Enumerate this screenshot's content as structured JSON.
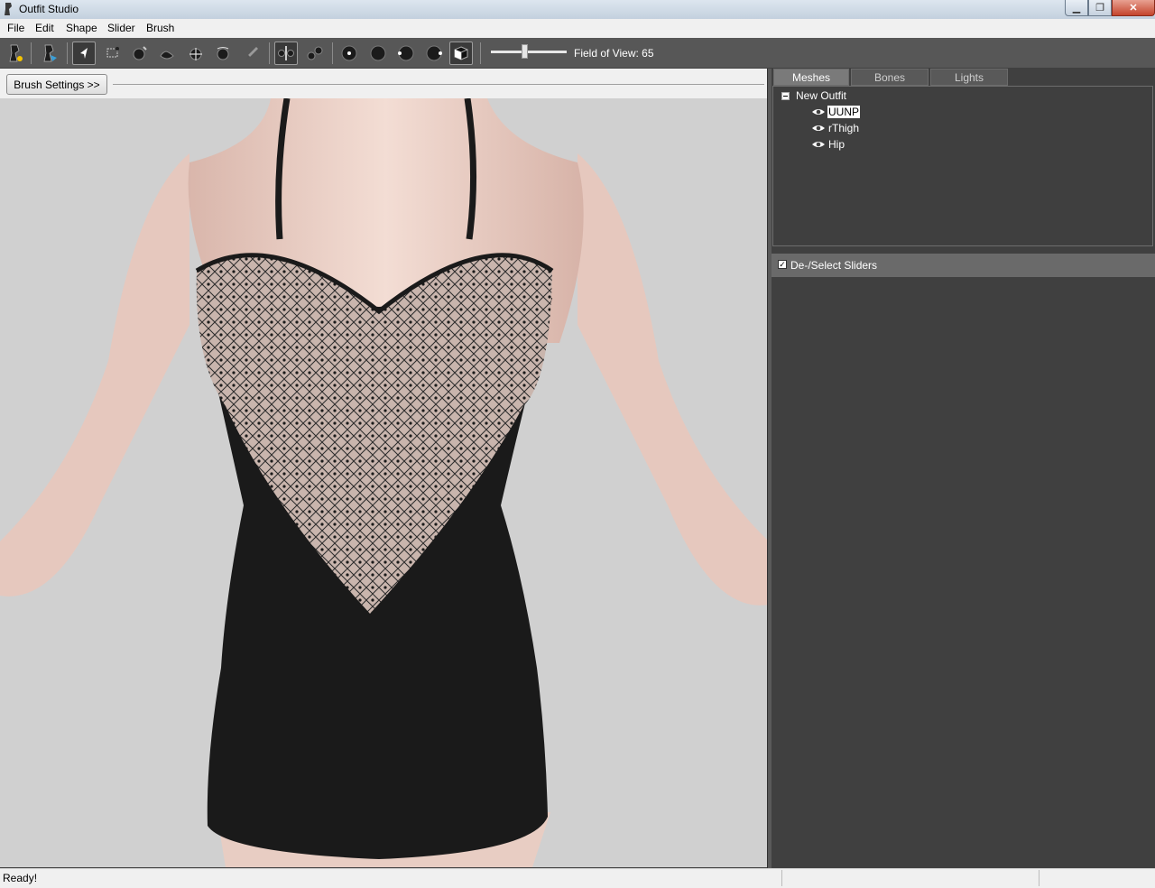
{
  "window": {
    "title": "Outfit Studio"
  },
  "menu": [
    "File",
    "Edit",
    "Shape",
    "Slider",
    "Brush"
  ],
  "toolbar": {
    "fov_label": "Field of View: 65",
    "fov_value": 65
  },
  "viewport": {
    "brush_settings_label": "Brush Settings >>"
  },
  "panel": {
    "tabs": [
      "Meshes",
      "Bones",
      "Lights"
    ],
    "tree": {
      "root": "New Outfit",
      "items": [
        "UUNP",
        "rThigh",
        "Hip"
      ]
    },
    "sliders_header": "De-/Select Sliders"
  },
  "status": {
    "text": "Ready!"
  },
  "colors": {
    "toolbar": "#575757",
    "panel": "#404040",
    "viewport": "#d0d0d0"
  }
}
